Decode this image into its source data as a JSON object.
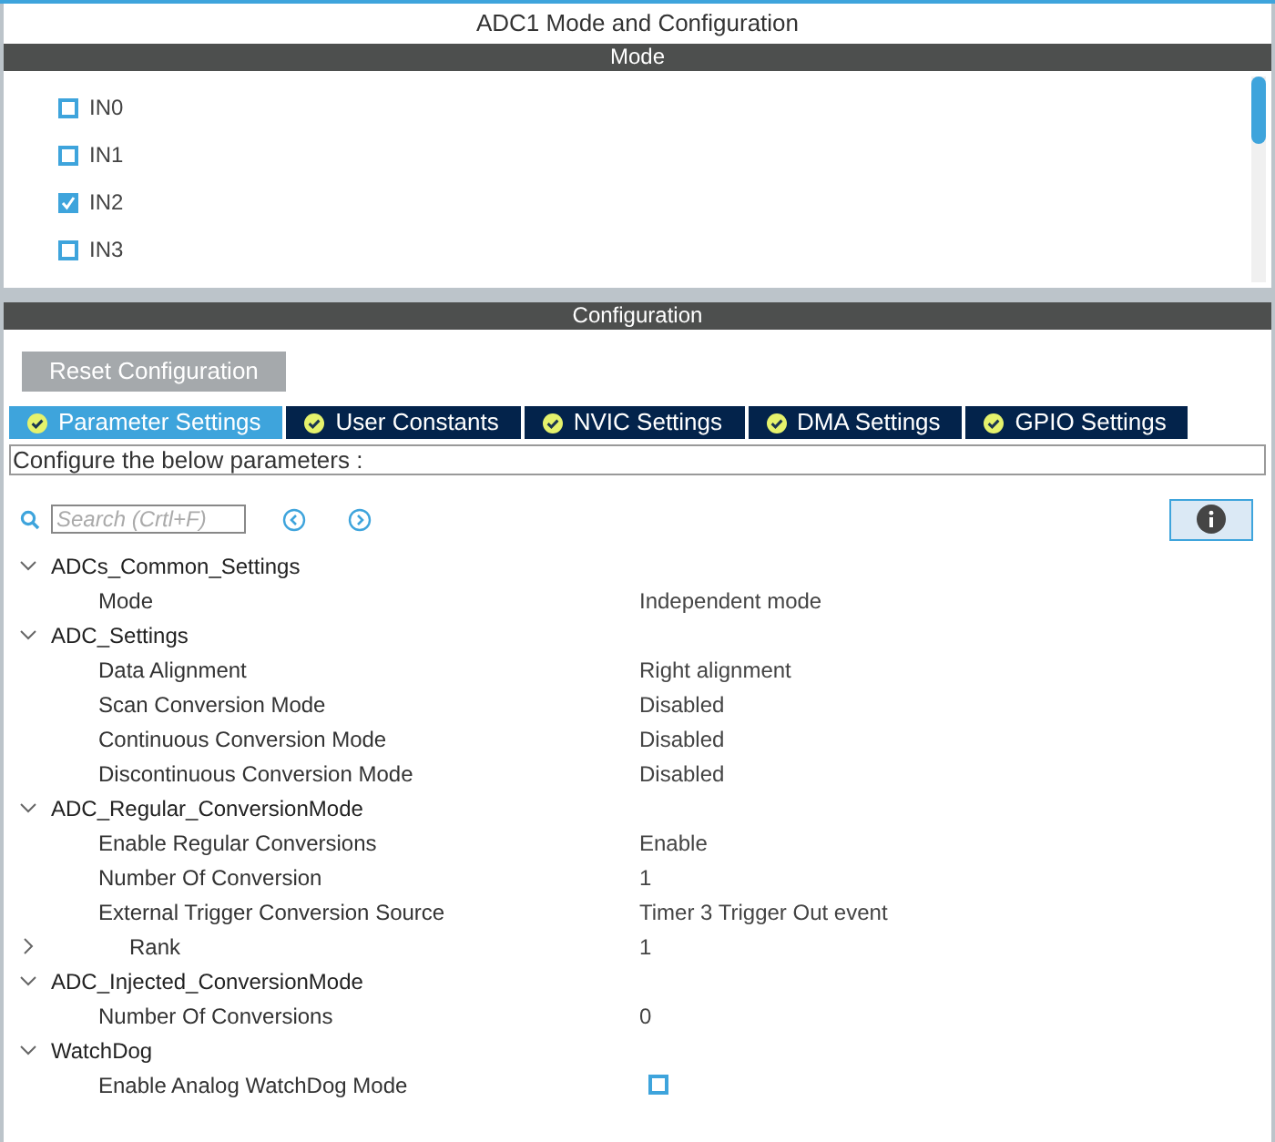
{
  "window": {
    "title": "ADC1 Mode and Configuration"
  },
  "mode": {
    "header": "Mode",
    "channels": [
      {
        "label": "IN0",
        "checked": false
      },
      {
        "label": "IN1",
        "checked": false
      },
      {
        "label": "IN2",
        "checked": true
      },
      {
        "label": "IN3",
        "checked": false
      }
    ]
  },
  "configuration": {
    "header": "Configuration",
    "reset_button": "Reset Configuration",
    "tabs": [
      {
        "label": "Parameter Settings",
        "selected": true
      },
      {
        "label": "User Constants",
        "selected": false
      },
      {
        "label": "NVIC Settings",
        "selected": false
      },
      {
        "label": "DMA Settings",
        "selected": false
      },
      {
        "label": "GPIO Settings",
        "selected": false
      }
    ],
    "description": "Configure the below parameters :",
    "search": {
      "placeholder": "Search (Crtl+F)"
    },
    "tree": [
      {
        "label": "ADCs_Common_Settings",
        "expanded": true,
        "children": [
          {
            "kind": "text",
            "label": "Mode",
            "value": "Independent mode"
          }
        ]
      },
      {
        "label": "ADC_Settings",
        "expanded": true,
        "children": [
          {
            "kind": "text",
            "label": "Data Alignment",
            "value": "Right alignment"
          },
          {
            "kind": "text",
            "label": "Scan Conversion Mode",
            "value": "Disabled"
          },
          {
            "kind": "text",
            "label": "Continuous Conversion Mode",
            "value": "Disabled"
          },
          {
            "kind": "text",
            "label": "Discontinuous Conversion Mode",
            "value": "Disabled"
          }
        ]
      },
      {
        "label": "ADC_Regular_ConversionMode",
        "expanded": true,
        "children": [
          {
            "kind": "text",
            "label": "Enable Regular Conversions",
            "value": "Enable"
          },
          {
            "kind": "text",
            "label": "Number Of Conversion",
            "value": "1"
          },
          {
            "kind": "text",
            "label": "External Trigger Conversion Source",
            "value": "Timer 3 Trigger Out event"
          },
          {
            "kind": "text",
            "label": "Rank",
            "value": "1",
            "expanded": false
          }
        ]
      },
      {
        "label": "ADC_Injected_ConversionMode",
        "expanded": true,
        "children": [
          {
            "kind": "text",
            "label": "Number Of Conversions",
            "value": "0"
          }
        ]
      },
      {
        "label": "WatchDog",
        "expanded": true,
        "children": [
          {
            "kind": "checkbox",
            "label": "Enable Analog WatchDog Mode",
            "checked": false
          }
        ]
      }
    ]
  }
}
